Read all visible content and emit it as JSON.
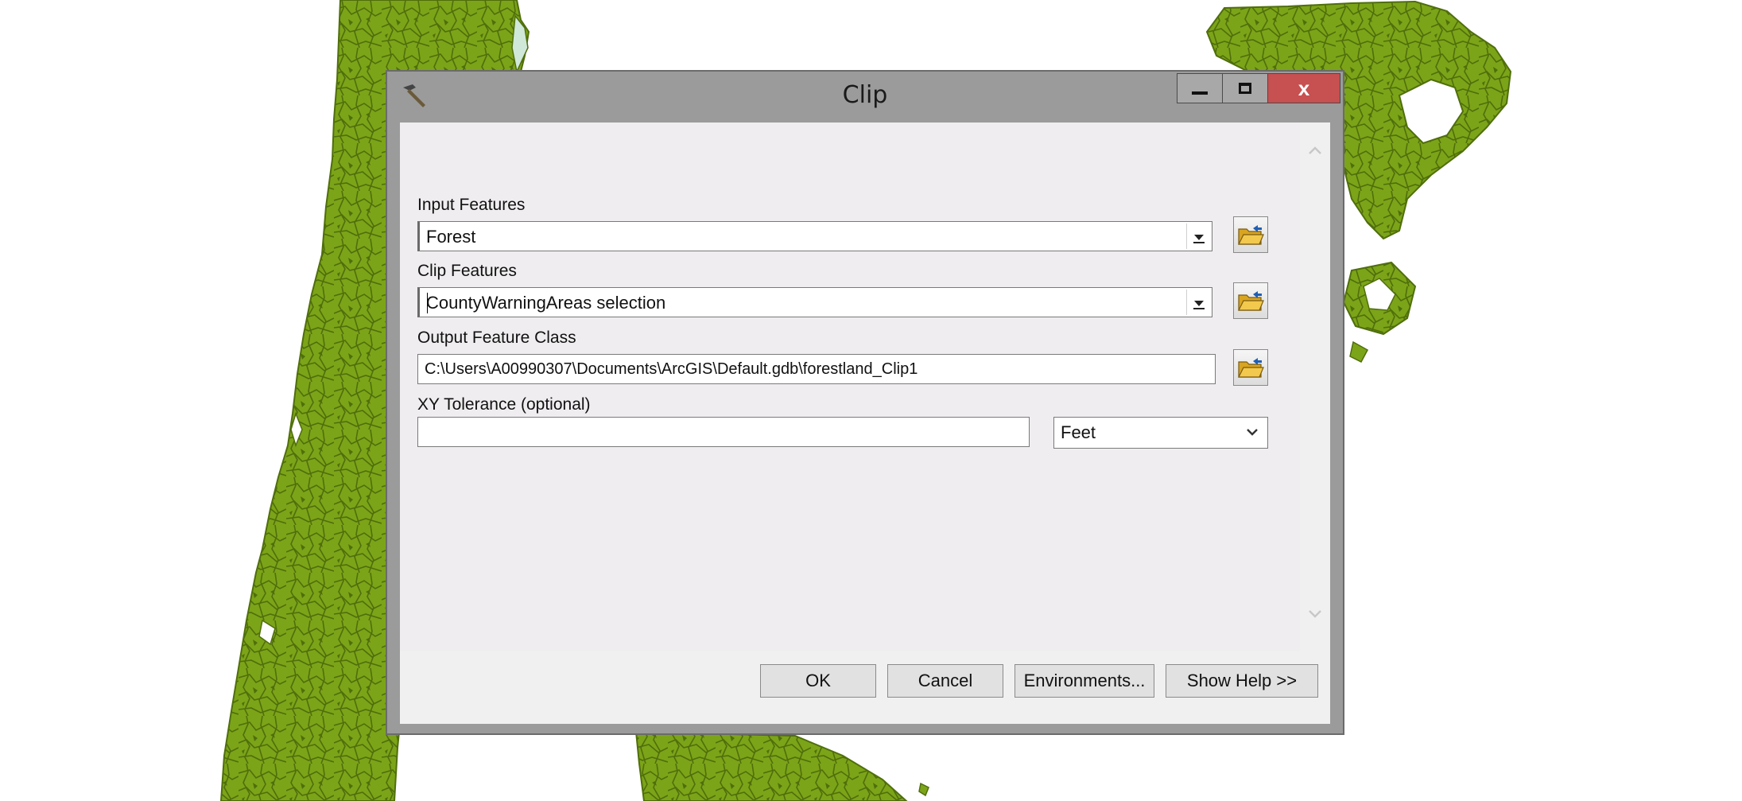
{
  "window": {
    "title": "Clip",
    "close_glyph": "x"
  },
  "form": {
    "input_features": {
      "label": "Input Features",
      "value": "Forest"
    },
    "clip_features": {
      "label": "Clip Features",
      "value": "CountyWarningAreas selection"
    },
    "output_feature_class": {
      "label": "Output Feature Class",
      "value": "C:\\Users\\A00990307\\Documents\\ArcGIS\\Default.gdb\\forestland_Clip1"
    },
    "xy_tolerance": {
      "label": "XY Tolerance (optional)",
      "value": "",
      "unit": "Feet"
    }
  },
  "buttons": {
    "ok": "OK",
    "cancel": "Cancel",
    "environments": "Environments...",
    "show_help": "Show Help >>"
  },
  "colors": {
    "map_fill": "#7ca418",
    "map_outline": "#4f6e0c",
    "close_button": "#c75050",
    "titlebar": "#9b9b9b"
  },
  "icons": {
    "title": "hammer-icon",
    "browse": "open-folder-icon",
    "dropdown": "chevron-down-icon"
  }
}
